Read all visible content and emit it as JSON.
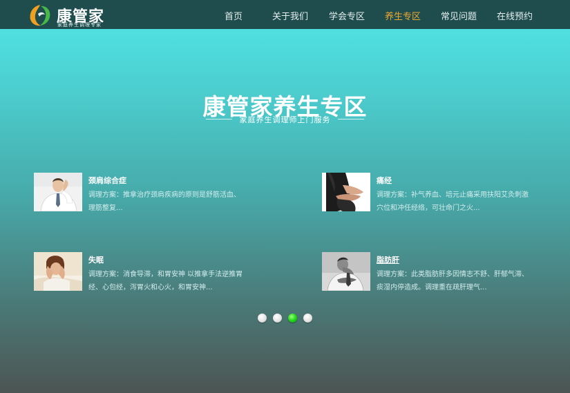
{
  "header": {
    "logo_title": "康管家",
    "logo_sub": "家庭养生调理专家",
    "nav": [
      {
        "label": "首页",
        "active": false
      },
      {
        "label": "关于我们",
        "active": false
      },
      {
        "label": "学会专区",
        "active": false
      },
      {
        "label": "养生专区",
        "active": true
      },
      {
        "label": "常见问题",
        "active": false
      },
      {
        "label": "在线预约",
        "active": false
      }
    ],
    "colors": {
      "bar": "#1f4d4d",
      "active": "#f0a830"
    }
  },
  "hero": {
    "title": "康管家养生专区",
    "subtitle": "家庭养生调理师上门服务"
  },
  "cards": [
    {
      "title": "颈肩综合症",
      "desc": "调理方案：推拿治疗颈肩疾病的原则是舒筋活血、理筋整复...",
      "icon": "office-man-neck-pain-photo"
    },
    {
      "title": "痛经",
      "desc": "调理方案：补气养血、培元止痛采用扶阳艾灸刺激穴位和冲任经络，可壮命门之火...",
      "icon": "woman-abdomen-pain-photo"
    },
    {
      "title": "失眠",
      "desc": "调理方案：消食导滞，和胃安神 以推拿手法逆推胃经、心包经，泻胃火和心火，和胃安神...",
      "icon": "woman-insomnia-photo"
    },
    {
      "title": "脂肪肝",
      "desc": "调理方案：此类脂肪肝多因情志不舒、肝郁气滞、痰湿内停造成。调理重在疏肝理气...",
      "icon": "man-stomach-pain-photo"
    }
  ],
  "carousel": {
    "total": 4,
    "active_index": 3,
    "colors": {
      "inactive": "#e4e4e4",
      "active": "#22d81a"
    }
  }
}
